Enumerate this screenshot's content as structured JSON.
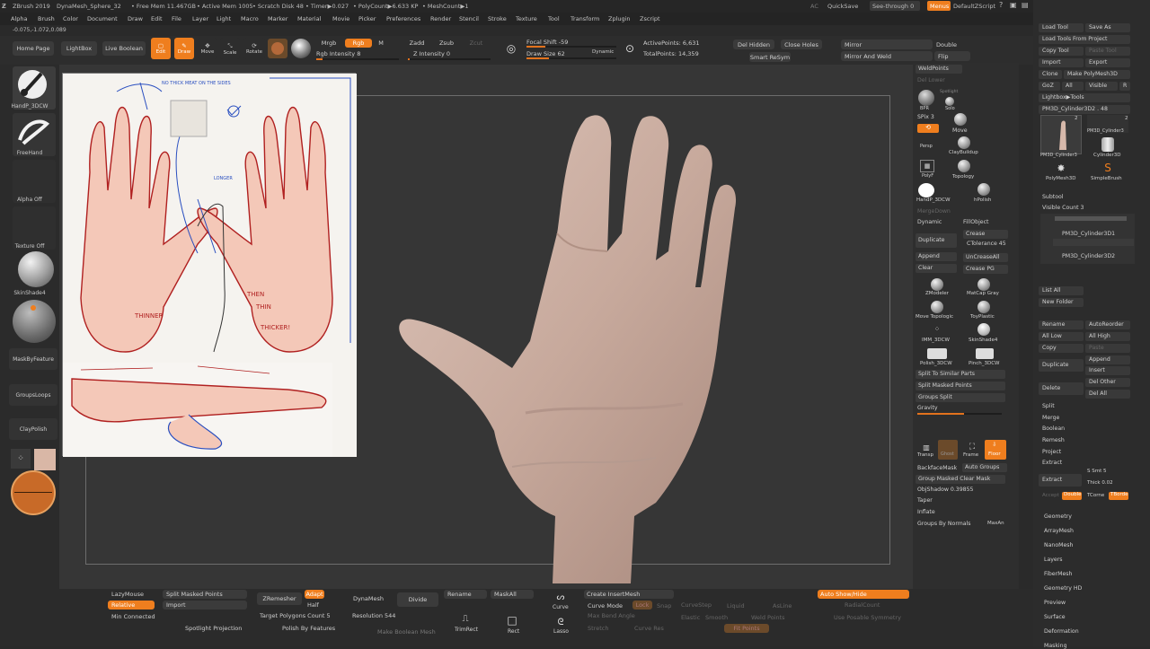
{
  "title_bar": {
    "app": "ZBrush 2019",
    "file": "DynaMesh_Sphere_32",
    "free_mem": "• Free Mem 11.467GB",
    "active_mem": "• Active Mem 1005",
    "scratch": "• Scratch Disk 48",
    "timer": "• Timer▶0.027",
    "polycount": "• PolyCount▶6.633 KP",
    "meshcount": "• MeshCount▶1",
    "ac": "AC",
    "quicksave": "QuickSave",
    "see_through": "See-through   0",
    "menus": "Menus",
    "default_script": "DefaultZScript"
  },
  "menu": [
    "Alpha",
    "Brush",
    "Color",
    "Document",
    "Draw",
    "Edit",
    "File",
    "Layer",
    "Light",
    "Macro",
    "Marker",
    "Material",
    "Movie",
    "Picker",
    "Preferences",
    "Render",
    "Stencil",
    "Stroke",
    "Texture",
    "Tool",
    "Transform",
    "Zplugin",
    "Zscript"
  ],
  "coords": "-0.075,-1.072,0.089",
  "toolbar": {
    "home_page": "Home Page",
    "lightbox": "LightBox",
    "live_boolean": "Live Boolean",
    "edit": "Edit",
    "draw": "Draw",
    "move": "Move",
    "scale": "Scale",
    "rotate": "Rotate",
    "mrgb": "Mrgb",
    "rgb": "Rgb",
    "m": "M",
    "rgb_intensity": "Rgb Intensity 8",
    "zadd": "Zadd",
    "zsub": "Zsub",
    "zcut": "Zcut",
    "z_intensity": "Z Intensity 0",
    "focal_shift": "Focal Shift -59",
    "draw_size": "Draw Size 62",
    "dynamic": "Dynamic",
    "active_points": "ActivePoints: 6,631",
    "total_points": "TotalPoints: 14,359",
    "del_hidden": "Del Hidden",
    "close_holes": "Close Holes",
    "smart_resym": "Smart ReSym",
    "mirror": "Mirror",
    "double": "Double",
    "mirror_weld": "Mirror And Weld",
    "flip": "Flip"
  },
  "left_shelf": [
    "HandP_3DCW",
    "FreeHand",
    "Alpha Off",
    "Texture Off",
    "SkinShade4",
    "MaskByFeature",
    "GroupsLoops",
    "ClayPolish"
  ],
  "right_panel": {
    "weld_points": "WeldPoints",
    "del_lower": "Del Lower",
    "bpr": "BPR",
    "spotlight": "Spotlight",
    "solo": "Solo",
    "spix": "SPix 3",
    "move": "Move",
    "persp": "Persp",
    "claybuildup": "ClayBuildup",
    "polyf": "PolyF",
    "topology": "Topology",
    "handp": "HandP_3DCW",
    "hpolish": "hPolish",
    "merge_down": "MergeDown",
    "dynamic": "Dynamic",
    "fill_object": "FillObject",
    "crease": "Crease",
    "duplicate": "Duplicate",
    "ctolerance": "CTolerance 45",
    "append": "Append",
    "uncrease_all": "UnCreaseAll",
    "clear": "Clear",
    "crease_pg": "Crease PG",
    "zmodeler": "ZModeler",
    "matcap_gray": "MatCap Gray",
    "move_topologic": "Move Topologic",
    "toyplastic": "ToyPlastic",
    "imm": "IMM_3DCW",
    "skinshade": "SkinShade4",
    "polish": "Polish_3DCW",
    "pinch": "Pinch_3DCW",
    "split_similar": "Split To Similar Parts",
    "split_masked": "Split Masked Points",
    "groups_split": "Groups Split",
    "gravity": "Gravity",
    "transp": "Transp",
    "ghost": "Ghost",
    "frame": "Frame",
    "floor": "Floor",
    "backface_mask": "BackfaceMask",
    "auto_groups": "Auto Groups",
    "group_masked_clear": "Group Masked Clear Mask",
    "objshadow": "ObjShadow 0.39855",
    "taper": "Taper",
    "inflate": "Inflate",
    "groups_by_normals": "Groups By Normals",
    "maxan": "MaxAn"
  },
  "tray": {
    "load_tool": "Load Tool",
    "save_as": "Save As",
    "load_tools_project": "Load Tools From Project",
    "copy_tool": "Copy Tool",
    "paste_tool": "Paste Tool",
    "import": "Import",
    "export": "Export",
    "clone": "Clone",
    "make_polymesh": "Make PolyMesh3D",
    "goz": "GoZ",
    "all": "All",
    "visible": "Visible",
    "r": "R",
    "lightbox_tools": "Lightbox▶Tools",
    "current_tool": "PM3D_Cylinder3D2 . 48",
    "thumb1_count": "2",
    "thumb2_count": "2",
    "thumb1": "PM3D_Cylinder3",
    "thumb2": "PM3D_Cylinder3",
    "thumb3": "Cylinder3D",
    "thumb4": "PolyMesh3D",
    "thumb5": "SimpleBrush",
    "subtool": "Subtool",
    "visible_count": "Visible Count 3",
    "sub1": "PM3D_Cylinder3D1",
    "sub2": "PM3D_Cylinder3D2",
    "list_all": "List All",
    "new_folder": "New Folder",
    "rename": "Rename",
    "auto_reorder": "AutoReorder",
    "all_low": "All Low",
    "all_high": "All High",
    "copy": "Copy",
    "paste": "Paste",
    "duplicate": "Duplicate",
    "append": "Append",
    "insert": "Insert",
    "delete": "Delete",
    "del_other": "Del Other",
    "del_all": "Del All",
    "split": "Split",
    "merge": "Merge",
    "boolean": "Boolean",
    "remesh": "Remesh",
    "project": "Project",
    "extract": "Extract",
    "extract_btn": "Extract",
    "s_smt": "S Smt 5",
    "thick": "Thick 0.02",
    "accept": "Accept",
    "double": "Double",
    "tcorne": "TCorne",
    "tborde": "TBorde",
    "sections": [
      "Geometry",
      "ArrayMesh",
      "NanoMesh",
      "Layers",
      "FiberMesh",
      "Geometry HD",
      "Preview",
      "Surface",
      "Deformation",
      "Masking"
    ]
  },
  "bottom": {
    "lazymouse": "LazyMouse",
    "relative": "Relative",
    "min_connected": "Min Connected",
    "split_masked": "Split Masked Points",
    "import": "Import",
    "spotlight_projection": "Spotlight Projection",
    "zremesher": "ZRemesher",
    "adapt": "Adapt",
    "half": "Half",
    "target_polys": "Target Polygons Count 5",
    "polish_by_features": "Polish By Features",
    "dynamesh": "DynaMesh",
    "divide": "Divide",
    "resolution": "Resolution 544",
    "make_boolean_mesh": "Make Boolean Mesh",
    "rename": "Rename",
    "maskall": "MaskAll",
    "trimrect": "TrimRect",
    "rect": "Rect",
    "curve": "Curve",
    "lasso": "Lasso",
    "create_insertmesh": "Create InsertMesh",
    "curve_mode": "Curve Mode",
    "lock": "Lock",
    "snap": "Snap",
    "curvestep": "CurveStep",
    "liquid": "Liquid",
    "asline": "AsLine",
    "max_bend": "Max Bend Angle",
    "elastic": "Elastic",
    "smooth": "Smooth",
    "weld_points": "Weld Points",
    "stretch": "Stretch",
    "curve_res": "Curve Res",
    "fit_points": "Fit Points",
    "auto_show_hide": "Auto Show/Hide",
    "radial_count": "RadialCount",
    "use_posable_symmetry": "Use Posable Symmetry"
  },
  "reference": {
    "note1": "NO THICK MEAT ON THE SIDES",
    "note2": "LONGER",
    "note3": "THINNER",
    "note4": "THIN",
    "note5": "THICKER!",
    "note6": "THEN"
  },
  "colors": {
    "accent": "#ef7e1e",
    "skin": "#c9aca0"
  }
}
